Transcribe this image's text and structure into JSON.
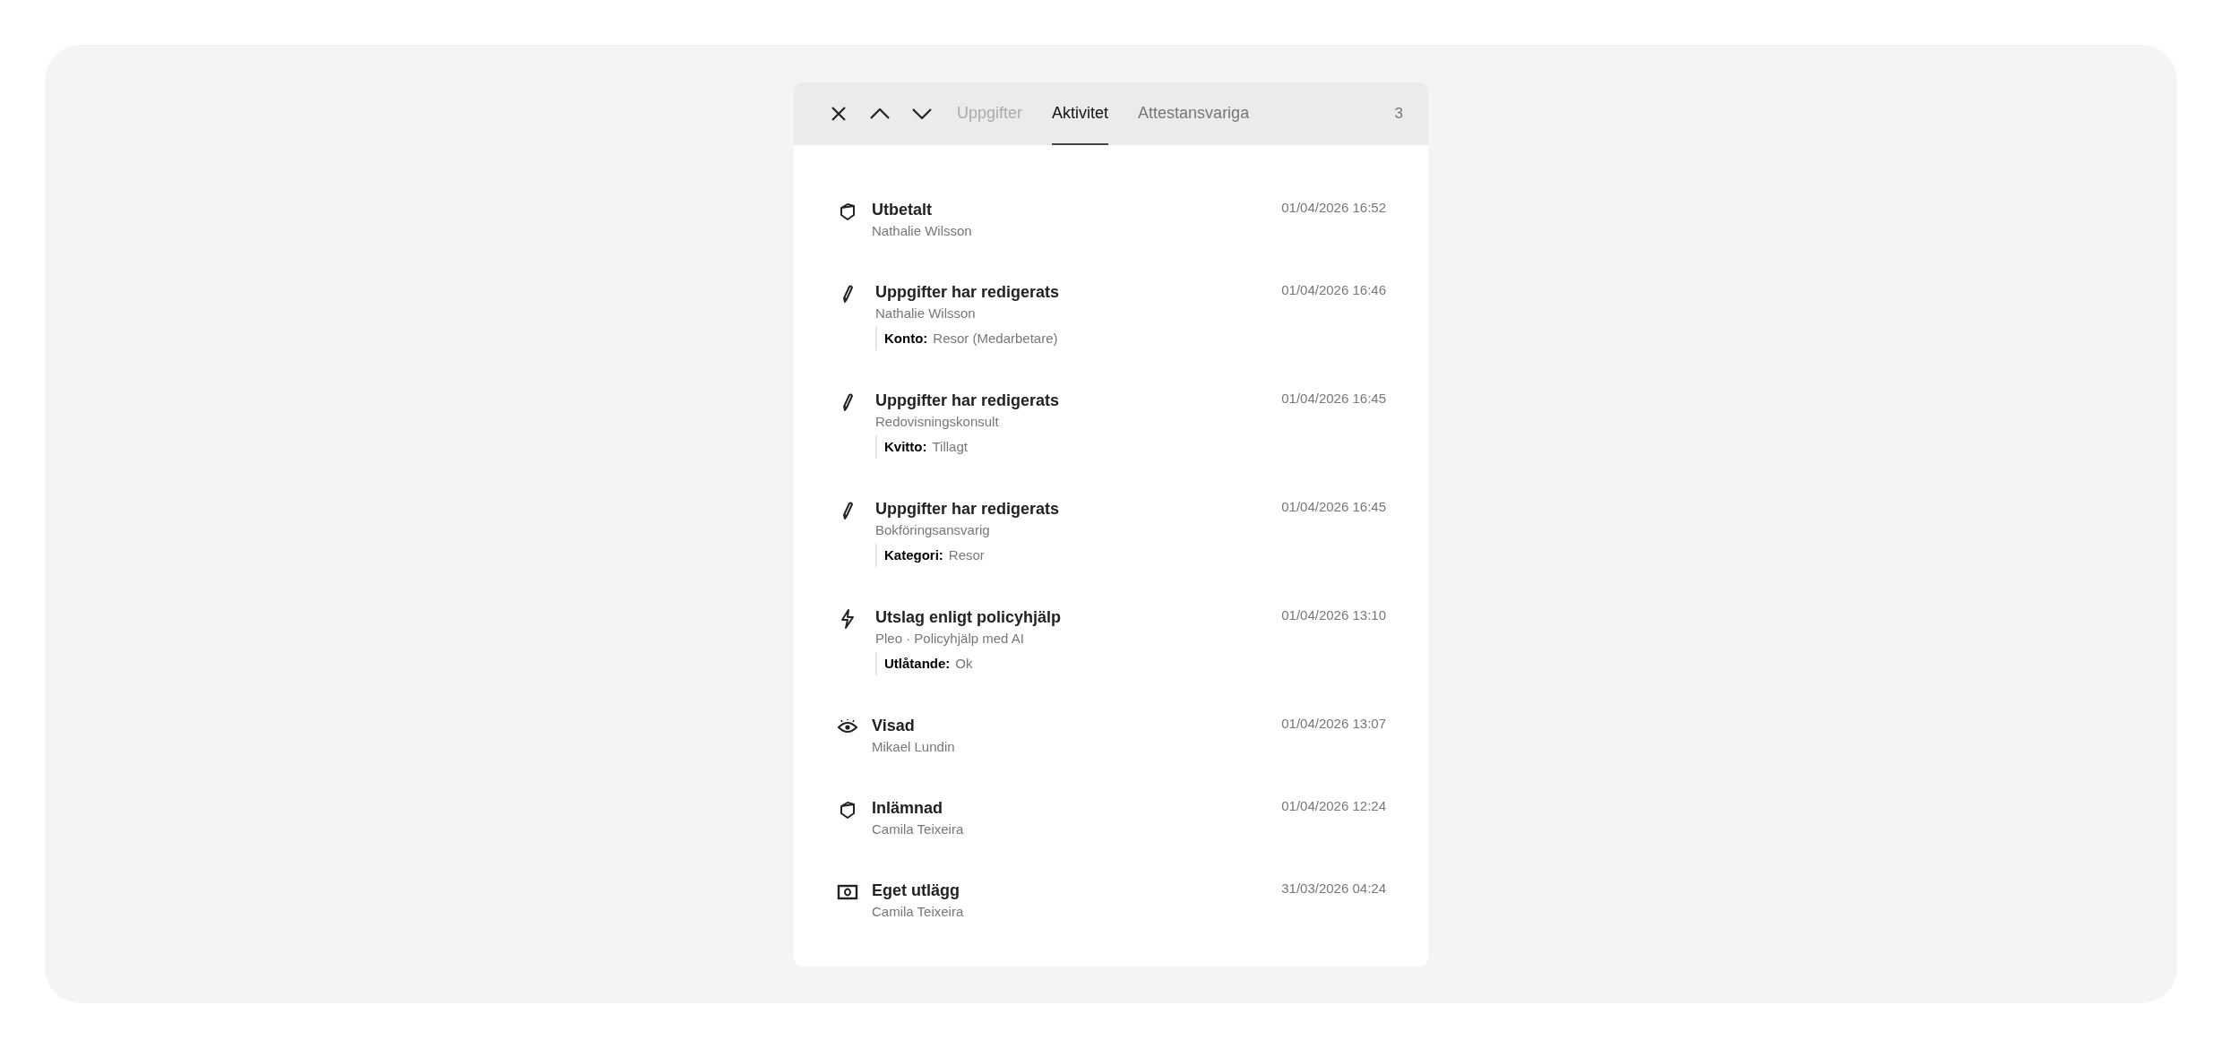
{
  "header": {
    "tabs": [
      {
        "label": "Uppgifter",
        "selected": false,
        "disabled": true
      },
      {
        "label": "Aktivitet",
        "selected": true,
        "disabled": false
      },
      {
        "label": "Attestansvariga",
        "selected": false,
        "disabled": false
      }
    ],
    "count": "3"
  },
  "activity": [
    {
      "kind": "box",
      "title": "Utbetalt",
      "subtitle": "Nathalie Wilsson",
      "time": "01/04/2026 16:52"
    },
    {
      "kind": "pencil",
      "title": "Uppgifter har redigerats",
      "subtitle": "Nathalie Wilsson",
      "time": "01/04/2026 16:46",
      "detail": {
        "label": "Konto:",
        "value": "Resor (Medarbetare)"
      }
    },
    {
      "kind": "pencil",
      "title": "Uppgifter har redigerats",
      "subtitle": "Redovisningskonsult",
      "time": "01/04/2026 16:45",
      "detail": {
        "label": "Kvitto:",
        "value": "Tillagt"
      }
    },
    {
      "kind": "pencil",
      "title": "Uppgifter har redigerats",
      "subtitle": "Bokföringsansvarig",
      "time": "01/04/2026 16:45",
      "detail": {
        "label": "Kategori:",
        "value": "Resor"
      }
    },
    {
      "kind": "bolt",
      "title": "Utslag enligt policyhjälp",
      "subtitle": "Pleo · Policyhjälp med AI",
      "time": "01/04/2026 13:10",
      "detail": {
        "label": "Utlåtande:",
        "value": "Ok"
      }
    },
    {
      "kind": "eye",
      "title": "Visad",
      "subtitle": "Mikael Lundin",
      "time": "01/04/2026 13:07"
    },
    {
      "kind": "box",
      "title": "Inlämnad",
      "subtitle": "Camila Teixeira",
      "time": "01/04/2026 12:24"
    },
    {
      "kind": "cash",
      "title": "Eget utlägg",
      "subtitle": "Camila Teixeira",
      "time": "31/03/2026 04:24"
    }
  ]
}
